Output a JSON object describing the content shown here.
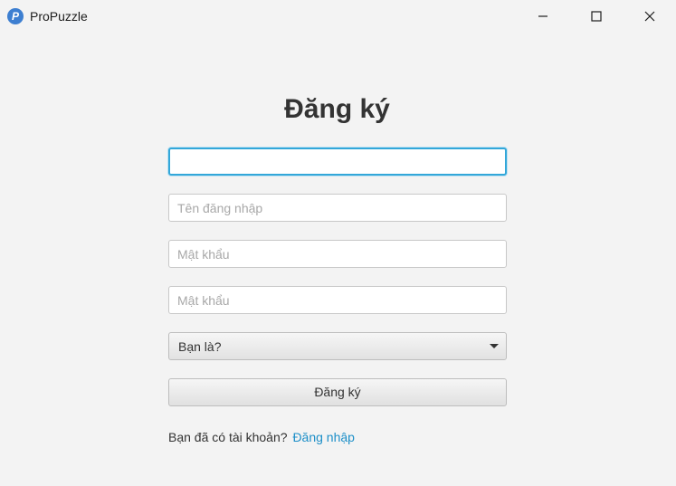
{
  "window": {
    "title": "ProPuzzle",
    "icon_letter": "P",
    "icon_color": "#3d7fd1"
  },
  "form": {
    "heading": "Đăng ký",
    "field1": {
      "value": "",
      "placeholder": ""
    },
    "username": {
      "value": "",
      "placeholder": "Tên đăng nhập"
    },
    "password": {
      "value": "",
      "placeholder": "Mật khẩu"
    },
    "confirm_password": {
      "value": "",
      "placeholder": "Mật khẩu"
    },
    "role_select": {
      "selected": "Bạn là?"
    },
    "submit_label": "Đăng ký",
    "footer_text": "Bạn đã có tài khoản?",
    "login_link": "Đăng nhập"
  },
  "colors": {
    "focus_border": "#33a7d9",
    "link": "#1d8fc8",
    "background": "#f3f3f3"
  }
}
